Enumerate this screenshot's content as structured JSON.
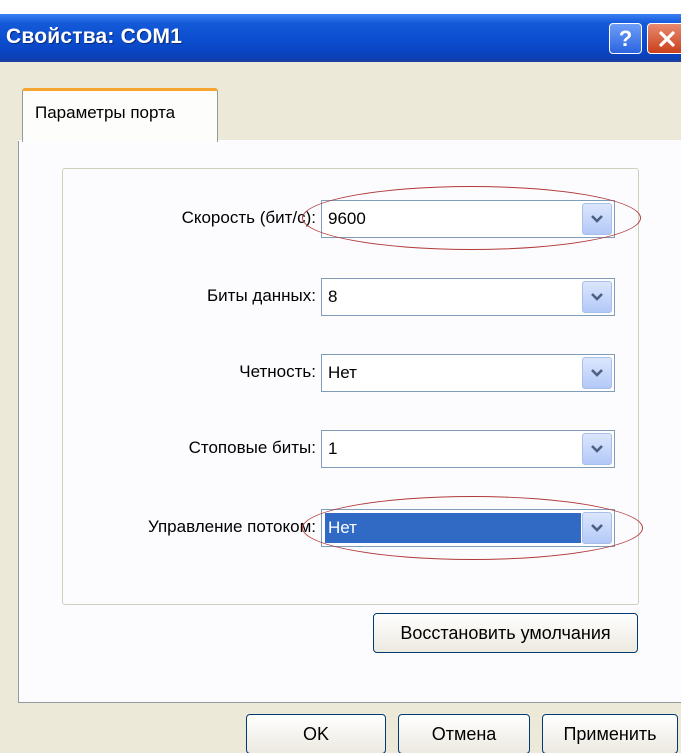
{
  "window": {
    "title": "Свойства: COM1",
    "help_label": "?",
    "close_icon": "close-x-icon"
  },
  "tabs": [
    {
      "label": "Параметры порта",
      "active": true
    }
  ],
  "fields": [
    {
      "label": "Скорость (бит/с):",
      "value": "9600",
      "selected": false,
      "circled": true
    },
    {
      "label": "Биты данных:",
      "value": "8",
      "selected": false,
      "circled": false
    },
    {
      "label": "Четность:",
      "value": "Нет",
      "selected": false,
      "circled": false
    },
    {
      "label": "Стоповые биты:",
      "value": "1",
      "selected": false,
      "circled": false
    },
    {
      "label": "Управление потоком:",
      "value": "Нет",
      "selected": true,
      "circled": true
    }
  ],
  "buttons": {
    "restore_defaults": "Восстановить умолчания",
    "ok": "OK",
    "cancel": "Отмена",
    "apply": "Применить"
  },
  "colors": {
    "titlebar": "#0b4fd0",
    "tab_accent": "#f6a52f",
    "selection": "#316ac5",
    "annotation": "#b23a3a"
  }
}
